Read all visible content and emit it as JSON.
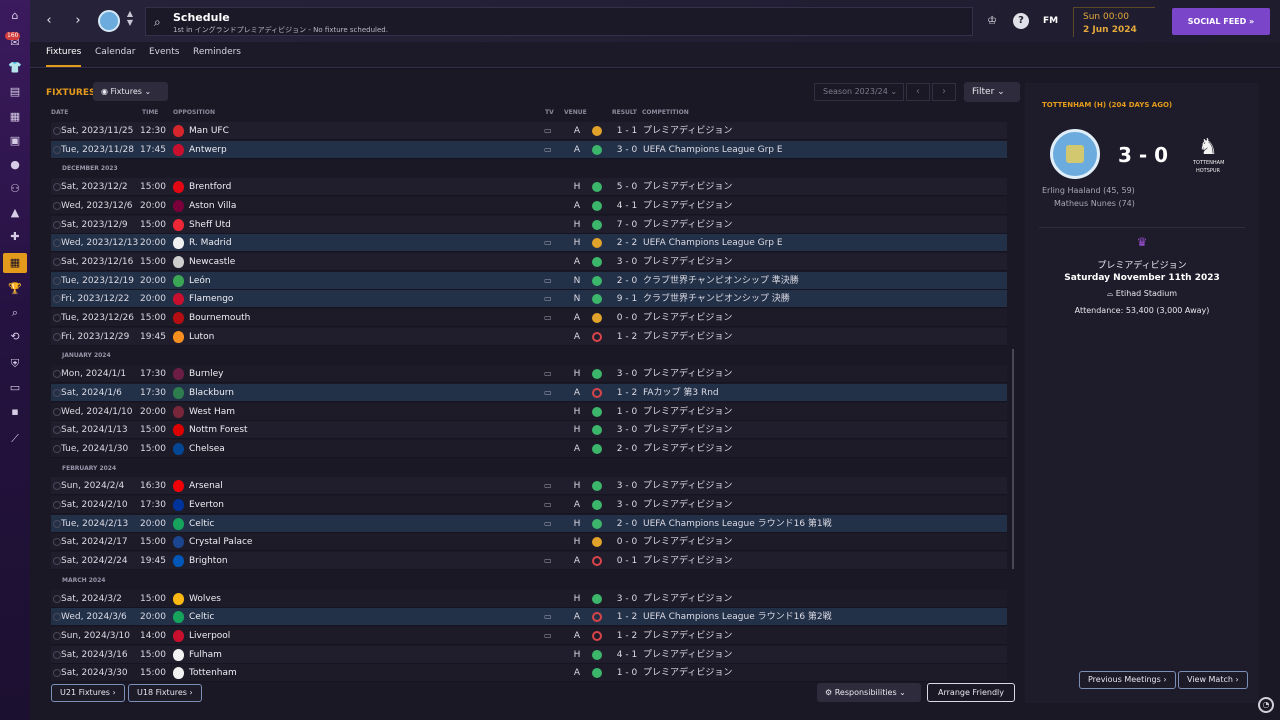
{
  "topbar": {
    "title": "Schedule",
    "subtitle": "1st in イングランドプレミアディビジョン - No fixture scheduled.",
    "fm_logo": "FM",
    "time": "Sun 00:00",
    "date": "2 Jun 2024",
    "social_feed_label": "SOCIAL FEED »",
    "notification_count": "160"
  },
  "subnav": {
    "tabs": [
      "Fixtures",
      "Calendar",
      "Events",
      "Reminders"
    ],
    "active": "Fixtures"
  },
  "toolbar": {
    "heading": "FIXTURES",
    "view_label": "Fixtures",
    "season": "Season 2023/24",
    "filter_label": "Filter"
  },
  "columns": {
    "date": "DATE",
    "time": "TIME",
    "opposition": "OPPOSITION",
    "tv": "TV",
    "venue": "VENUE",
    "result": "RESULT",
    "competition": "COMPETITION"
  },
  "months": {
    "dec": "DECEMBER 2023",
    "jan": "JANUARY 2024",
    "feb": "FEBRUARY 2024",
    "mar": "MARCH 2024"
  },
  "fixtures": [
    {
      "date": "Sat, 2023/11/25",
      "time": "12:30",
      "opp": "Man UFC",
      "tv": true,
      "venue": "A",
      "res": "d",
      "score": "1 - 1",
      "comp": "プレミアディビジョン",
      "crest": "#d6262c"
    },
    {
      "date": "Tue, 2023/11/28",
      "time": "17:45",
      "opp": "Antwerp",
      "tv": true,
      "venue": "A",
      "res": "w",
      "score": "3 - 0",
      "comp": "UEFA Champions League Grp E",
      "crest": "#c8102e"
    },
    {
      "date": "Sat, 2023/12/2",
      "time": "15:00",
      "opp": "Brentford",
      "tv": false,
      "venue": "H",
      "res": "w",
      "score": "5 - 0",
      "comp": "プレミアディビジョン",
      "crest": "#e30613"
    },
    {
      "date": "Wed, 2023/12/6",
      "time": "20:00",
      "opp": "Aston Villa",
      "tv": false,
      "venue": "A",
      "res": "w",
      "score": "4 - 1",
      "comp": "プレミアディビジョン",
      "crest": "#7a003c"
    },
    {
      "date": "Sat, 2023/12/9",
      "time": "15:00",
      "opp": "Sheff Utd",
      "tv": false,
      "venue": "H",
      "res": "w",
      "score": "7 - 0",
      "comp": "プレミアディビジョン",
      "crest": "#ee2737"
    },
    {
      "date": "Wed, 2023/12/13",
      "time": "20:00",
      "opp": "R. Madrid",
      "tv": true,
      "venue": "H",
      "res": "d",
      "score": "2 - 2",
      "comp": "UEFA Champions League Grp E",
      "crest": "#f1f1f1"
    },
    {
      "date": "Sat, 2023/12/16",
      "time": "15:00",
      "opp": "Newcastle",
      "tv": false,
      "venue": "A",
      "res": "w",
      "score": "3 - 0",
      "comp": "プレミアディビジョン",
      "crest": "#cfcfcf"
    },
    {
      "date": "Tue, 2023/12/19",
      "time": "20:00",
      "opp": "León",
      "tv": true,
      "venue": "N",
      "res": "w",
      "score": "2 - 0",
      "comp": "クラブ世界チャンピオンシップ 準決勝",
      "crest": "#3aa655"
    },
    {
      "date": "Fri, 2023/12/22",
      "time": "20:00",
      "opp": "Flamengo",
      "tv": true,
      "venue": "N",
      "res": "w",
      "score": "9 - 1",
      "comp": "クラブ世界チャンピオンシップ 決勝",
      "crest": "#c8102e"
    },
    {
      "date": "Tue, 2023/12/26",
      "time": "15:00",
      "opp": "Bournemouth",
      "tv": true,
      "venue": "A",
      "res": "d",
      "score": "0 - 0",
      "comp": "プレミアディビジョン",
      "crest": "#b50e12"
    },
    {
      "date": "Fri, 2023/12/29",
      "time": "19:45",
      "opp": "Luton",
      "tv": false,
      "venue": "A",
      "res": "l",
      "score": "1 - 2",
      "comp": "プレミアディビジョン",
      "crest": "#f78f1e"
    },
    {
      "date": "Mon, 2024/1/1",
      "time": "17:30",
      "opp": "Burnley",
      "tv": true,
      "venue": "H",
      "res": "w",
      "score": "3 - 0",
      "comp": "プレミアディビジョン",
      "crest": "#6c1d45"
    },
    {
      "date": "Sat, 2024/1/6",
      "time": "17:30",
      "opp": "Blackburn",
      "tv": true,
      "venue": "A",
      "res": "l",
      "score": "1 - 2",
      "comp": "FAカップ 第3 Rnd",
      "crest": "#2e7d4f"
    },
    {
      "date": "Wed, 2024/1/10",
      "time": "20:00",
      "opp": "West Ham",
      "tv": false,
      "venue": "H",
      "res": "w",
      "score": "1 - 0",
      "comp": "プレミアディビジョン",
      "crest": "#7a263a"
    },
    {
      "date": "Sat, 2024/1/13",
      "time": "15:00",
      "opp": "Nottm Forest",
      "tv": false,
      "venue": "H",
      "res": "w",
      "score": "3 - 0",
      "comp": "プレミアディビジョン",
      "crest": "#dd0000"
    },
    {
      "date": "Tue, 2024/1/30",
      "time": "15:00",
      "opp": "Chelsea",
      "tv": false,
      "venue": "A",
      "res": "w",
      "score": "2 - 0",
      "comp": "プレミアディビジョン",
      "crest": "#034694"
    },
    {
      "date": "Sun, 2024/2/4",
      "time": "16:30",
      "opp": "Arsenal",
      "tv": true,
      "venue": "H",
      "res": "w",
      "score": "3 - 0",
      "comp": "プレミアディビジョン",
      "crest": "#ef0107"
    },
    {
      "date": "Sat, 2024/2/10",
      "time": "17:30",
      "opp": "Everton",
      "tv": true,
      "venue": "A",
      "res": "w",
      "score": "3 - 0",
      "comp": "プレミアディビジョン",
      "crest": "#003399"
    },
    {
      "date": "Tue, 2024/2/13",
      "time": "20:00",
      "opp": "Celtic",
      "tv": true,
      "venue": "H",
      "res": "w",
      "score": "2 - 0",
      "comp": "UEFA Champions League ラウンド16 第1戦",
      "crest": "#16a35b"
    },
    {
      "date": "Sat, 2024/2/17",
      "time": "15:00",
      "opp": "Crystal Palace",
      "tv": false,
      "venue": "H",
      "res": "d",
      "score": "0 - 0",
      "comp": "プレミアディビジョン",
      "crest": "#1b458f"
    },
    {
      "date": "Sat, 2024/2/24",
      "time": "19:45",
      "opp": "Brighton",
      "tv": true,
      "venue": "A",
      "res": "l",
      "score": "0 - 1",
      "comp": "プレミアディビジョン",
      "crest": "#0057b8"
    },
    {
      "date": "Sat, 2024/3/2",
      "time": "15:00",
      "opp": "Wolves",
      "tv": false,
      "venue": "H",
      "res": "w",
      "score": "3 - 0",
      "comp": "プレミアディビジョン",
      "crest": "#fdb913"
    },
    {
      "date": "Wed, 2024/3/6",
      "time": "20:00",
      "opp": "Celtic",
      "tv": true,
      "venue": "A",
      "res": "l",
      "score": "1 - 2",
      "comp": "UEFA Champions League ラウンド16 第2戦",
      "crest": "#16a35b"
    },
    {
      "date": "Sun, 2024/3/10",
      "time": "14:00",
      "opp": "Liverpool",
      "tv": true,
      "venue": "A",
      "res": "l",
      "score": "1 - 2",
      "comp": "プレミアディビジョン",
      "crest": "#c8102e"
    },
    {
      "date": "Sat, 2024/3/16",
      "time": "15:00",
      "opp": "Fulham",
      "tv": false,
      "venue": "H",
      "res": "w",
      "score": "4 - 1",
      "comp": "プレミアディビジョン",
      "crest": "#f2f2f2"
    },
    {
      "date": "Sat, 2024/3/30",
      "time": "15:00",
      "opp": "Tottenham",
      "tv": false,
      "venue": "A",
      "res": "w",
      "score": "1 - 0",
      "comp": "プレミアディビジョン",
      "crest": "#f2f2f2"
    }
  ],
  "bottom": {
    "u21": "U21 Fixtures ›",
    "u18": "U18 Fixtures ›",
    "responsibilities": "Responsibilities",
    "arrange": "Arrange Friendly"
  },
  "side": {
    "title": "TOTTENHAM (H) (204 DAYS AGO)",
    "score": "3 - 0",
    "away_crest_text": "TOTTENHAM HOTSPUR",
    "scorer1": "Erling Haaland (45, 59)",
    "scorer2": "Matheus Nunes (74)",
    "competition": "プレミアディビジョン",
    "date": "Saturday November 11th 2023",
    "stadium": "Etihad Stadium",
    "attendance": "Attendance: 53,400 (3,000 Away)",
    "prev_meetings": "Previous Meetings ›",
    "view_match": "View Match ›"
  }
}
